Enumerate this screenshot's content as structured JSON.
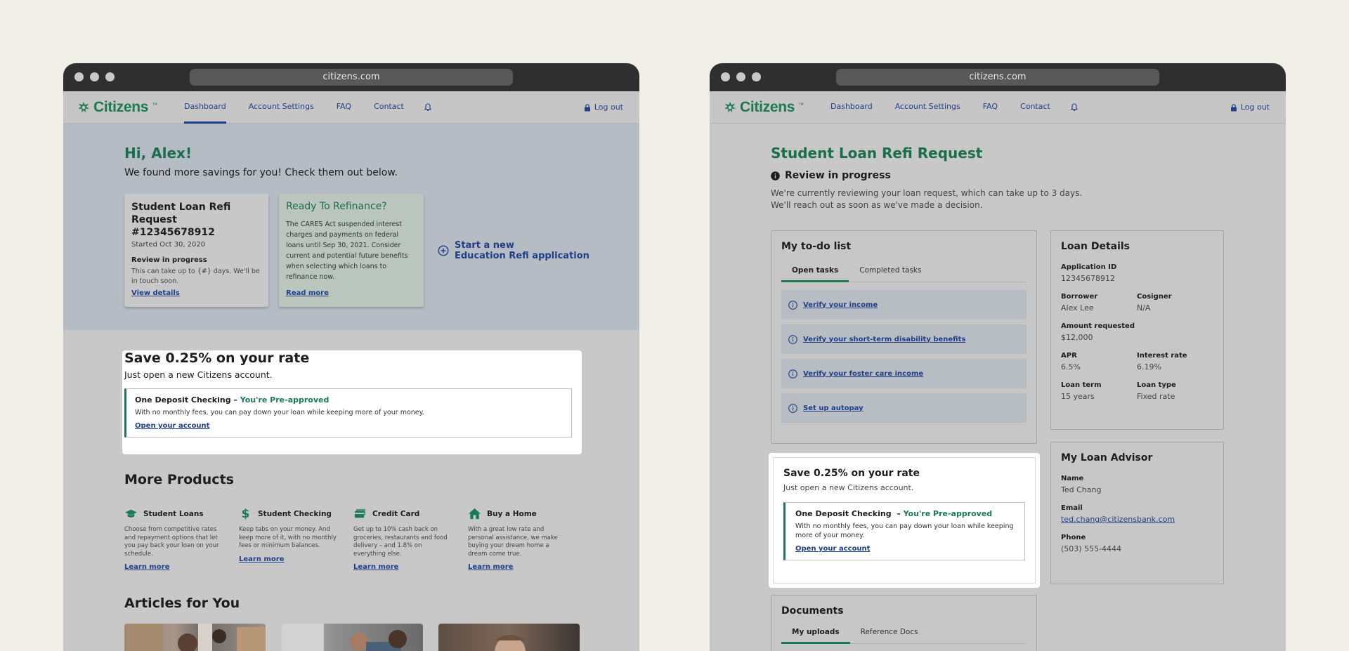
{
  "left": {
    "url": "citizens.com",
    "logo": "Citizens",
    "nav": {
      "links": [
        "Dashboard",
        "Account Settings",
        "FAQ",
        "Contact"
      ],
      "logout": "Log out"
    },
    "greeting": "Hi, Alex!",
    "subgreeting": "We found more savings for you! Check them out below.",
    "card1": {
      "title": "Student Loan Refi Request #12345678912",
      "started": "Started Oct 30, 2020",
      "status": "Review in progress",
      "text": "This can take up to {#} days. We'll be in touch soon.",
      "link": "View details"
    },
    "card2": {
      "title": "Ready To Refinance?",
      "text": "The CARES Act suspended interest charges and payments on federal loans until Sep 30, 2021. Consider current and potential future benefits when selecting which loans to refinance now.",
      "link": "Read more"
    },
    "start": {
      "line1": "Start a new",
      "line2": "Education Refi application"
    },
    "save": {
      "title": "Save 0.25% on your rate",
      "subtitle": "Just open a new Citizens account.",
      "offer_name": "One Deposit Checking – ",
      "offer_badge": "You're Pre-approved",
      "offer_text": "With no monthly fees, you can pay down your loan while keeping more of your money.",
      "offer_link": "Open your account"
    },
    "more_products": "More Products",
    "products": [
      {
        "name": "Student Loans",
        "text": "Choose from competitive rates and repayment options that let you pay back your loan on your schedule.",
        "link": "Learn more",
        "icon": "graduation-cap-icon"
      },
      {
        "name": "Student Checking",
        "text": "Keep tabs on your money. And keep more of it, with no monthly fees or minimum balances.",
        "link": "Learn more",
        "icon": "dollar-icon"
      },
      {
        "name": "Credit Card",
        "text": "Get up to 10% cash back on groceries, restaurants and food delivery – and 1.8% on everything else.",
        "link": "Learn more",
        "icon": "credit-card-icon"
      },
      {
        "name": "Buy a Home",
        "text": "With a great low rate and personal assistance, we make buying your dream home a dream come true.",
        "link": "Learn more",
        "icon": "home-icon"
      }
    ],
    "articles": "Articles for You"
  },
  "right": {
    "url": "citizens.com",
    "logo": "Citizens",
    "nav": {
      "links": [
        "Dashboard",
        "Account Settings",
        "FAQ",
        "Contact"
      ],
      "logout": "Log out"
    },
    "title": "Student Loan Refi Request",
    "status": "Review in progress",
    "desc1": "We're currently reviewing your loan request, which can take up to 3 days.",
    "desc2": "We'll reach out as soon as we've made a decision.",
    "todo": {
      "title": "My to-do list",
      "tabs": [
        "Open tasks",
        "Completed tasks"
      ],
      "tasks": [
        "Verify your income",
        "Verify your short-term disability benefits",
        "Verify your foster care income",
        "Set up autopay"
      ]
    },
    "details": {
      "title": "Loan Details",
      "app_id_label": "Application ID",
      "app_id": "12345678912",
      "borrower_label": "Borrower",
      "borrower": "Alex Lee",
      "cosigner_label": "Cosigner",
      "cosigner": "N/A",
      "amount_label": "Amount requested",
      "amount": "$12,000",
      "apr_label": "APR",
      "apr": "6.5%",
      "rate_label": "Interest rate",
      "rate": "6.19%",
      "term_label": "Loan term",
      "term": "15 years",
      "type_label": "Loan type",
      "type": "Fixed rate"
    },
    "advisor": {
      "title": "My Loan Advisor",
      "name_label": "Name",
      "name": "Ted Chang",
      "email_label": "Email",
      "email": "ted.chang@citizensbank.com",
      "phone_label": "Phone",
      "phone": "(503) 555-4444"
    },
    "save": {
      "title": "Save 0.25% on your rate",
      "subtitle": "Just open a new Citizens account.",
      "offer_name": "One Deposit Checking  – ",
      "offer_badge": "You're Pre-approved",
      "offer_text": "With no monthly fees, you can pay down your loan while keeping more of your money.",
      "offer_link": "Open your account"
    },
    "docs": {
      "title": "Documents",
      "tabs": [
        "My uploads",
        "Reference Docs"
      ]
    }
  },
  "colors": {
    "brand_green": "#1a7a56",
    "link_blue": "#1f3f86",
    "background": "#f0efe8"
  }
}
